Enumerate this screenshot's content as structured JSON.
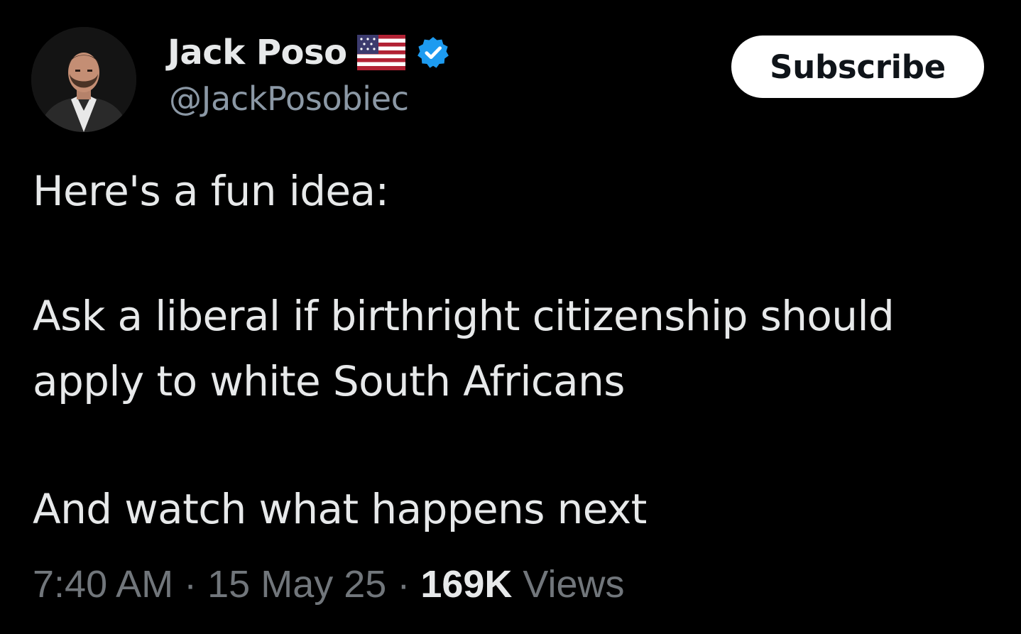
{
  "author": {
    "name": "Jack Poso",
    "handle": "@JackPosobiec",
    "flag_icon": "us-flag-icon",
    "verified_icon": "verified-badge-icon",
    "verified_color": "#1d9bf0"
  },
  "subscribe_button": {
    "label": "Subscribe"
  },
  "tweet": {
    "lines": [
      "Here's a fun idea:",
      "Ask a liberal if birthright citizenship should",
      "apply to white South Africans",
      "And watch what happens next"
    ]
  },
  "meta": {
    "time": "7:40 AM",
    "separator": "·",
    "date": "15 May 25",
    "views_count": "169K",
    "views_label": "Views"
  },
  "colors": {
    "background": "#000000",
    "text_primary": "#e7e9ea",
    "text_secondary": "#71767b",
    "button_bg": "#ffffff"
  }
}
